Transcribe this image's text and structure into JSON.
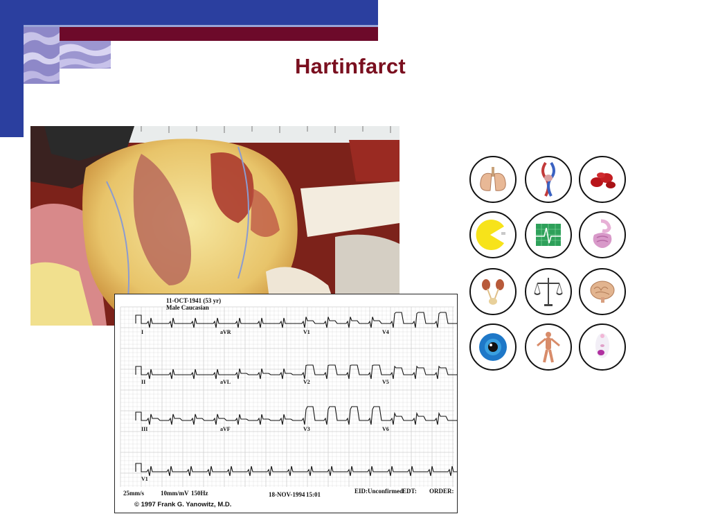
{
  "slide": {
    "title": "Hartinfarct"
  },
  "ecg": {
    "patient_date": "11-OCT-1941 (53 yr)",
    "patient_sex": "Male    Caucasian",
    "lead_labels": [
      "I",
      "aVR",
      "V1",
      "V4",
      "II",
      "aVL",
      "V2",
      "V5",
      "III",
      "aVF",
      "V3",
      "V6",
      "V1"
    ],
    "speed": "25mm/s",
    "gain": "10mm/mV",
    "filter": "150Hz",
    "record_date": "18-NOV-1994",
    "record_time": "15:01",
    "eid": "EID:Unconfirmed",
    "edt": "EDT:",
    "order": "ORDER:",
    "copyright": "© 1997 Frank G. Yanowitz, M.D."
  },
  "icons": [
    {
      "name": "lungs-icon"
    },
    {
      "name": "circulation-icon"
    },
    {
      "name": "blood-cells-icon"
    },
    {
      "name": "pacman-icon"
    },
    {
      "name": "ecg-monitor-icon"
    },
    {
      "name": "digestive-system-icon"
    },
    {
      "name": "kidneys-icon"
    },
    {
      "name": "scales-icon"
    },
    {
      "name": "brain-icon"
    },
    {
      "name": "eye-icon"
    },
    {
      "name": "muscles-icon"
    },
    {
      "name": "endocrine-icon"
    }
  ],
  "colors": {
    "header_blue": "#2b3f9f",
    "header_maroon": "#6d0a2a",
    "title": "#7a0f1f"
  }
}
